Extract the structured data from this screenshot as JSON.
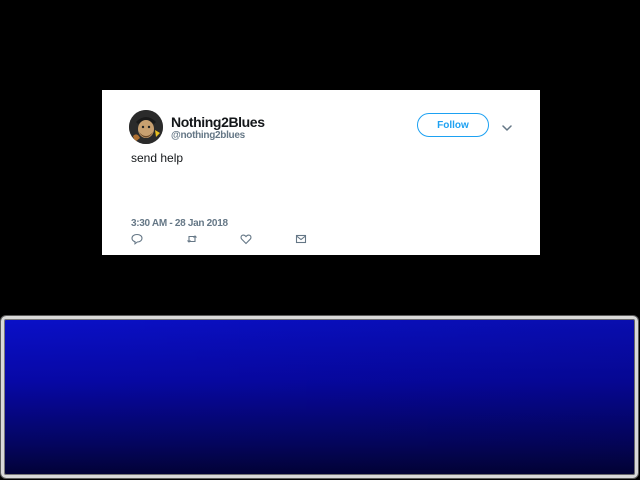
{
  "tweet": {
    "display_name": "Nothing2Blues",
    "handle": "@nothing2blues",
    "follow_label": "Follow",
    "text": "send help",
    "timestamp": "3:30 AM - 28 Jan 2018",
    "actions": [
      "reply-icon",
      "retweet-icon",
      "like-icon",
      "message-icon"
    ]
  },
  "dialog": {
    "text": ""
  },
  "colors": {
    "background": "#000000",
    "card": "#ffffff",
    "follow_accent": "#1da1f2",
    "muted_text": "#657786",
    "dialog_blue_top": "#0a10c8",
    "dialog_blue_bottom": "#020236",
    "dialog_border": "#d9d9d9"
  }
}
